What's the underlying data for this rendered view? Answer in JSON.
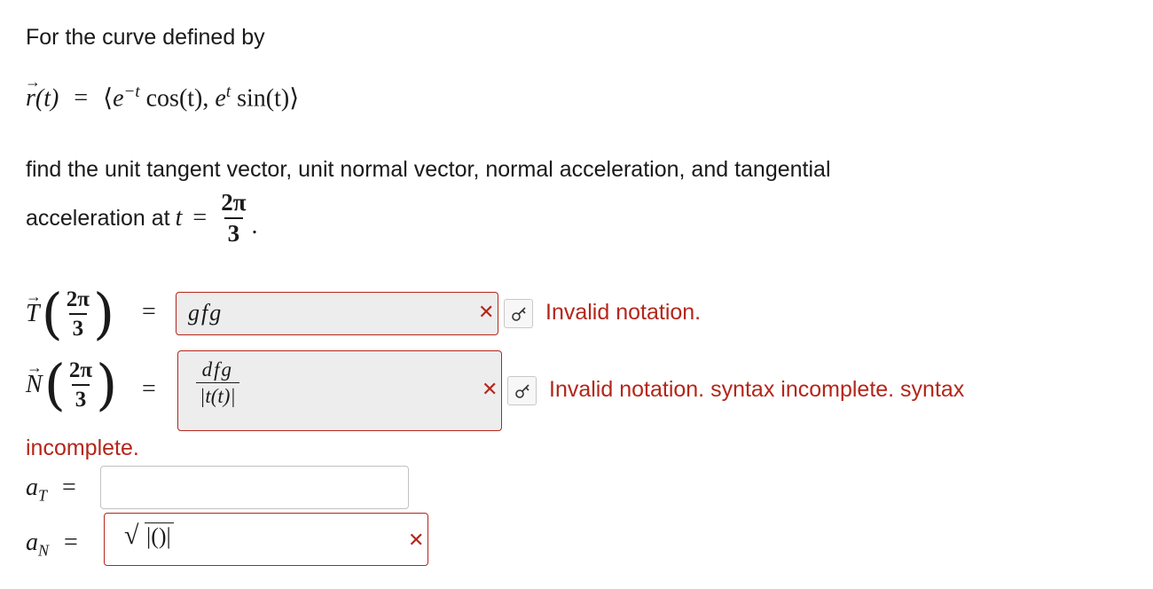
{
  "problem": {
    "intro": "For the curve defined by",
    "r_lhs": "r(t) =",
    "r_comp1_base": "e",
    "r_comp1_exp": "−t",
    "r_comp1_rest": "cos(t),",
    "r_comp2_base": "e",
    "r_comp2_exp": "t",
    "r_comp2_rest": "sin(t)",
    "instruction_line1": "find the unit tangent vector, unit normal vector, normal acceleration, and tangential",
    "instruction_line2": "acceleration at",
    "t_var": "t",
    "equals": "=",
    "frac_num": "2π",
    "frac_den": "3",
    "period": "."
  },
  "rows": {
    "tangent": {
      "symbol": "T",
      "frac_num": "2π",
      "frac_den": "3",
      "equals": "=",
      "value": "gfg",
      "error": "Invalid notation."
    },
    "normal": {
      "symbol": "N",
      "frac_num": "2π",
      "frac_den": "3",
      "equals": "=",
      "value_num": "dfg",
      "value_den": "|t(t)|",
      "error": "Invalid notation. syntax incomplete. syntax",
      "error_wrap": "incomplete."
    },
    "a_t": {
      "symbol": "a",
      "subscript": "T",
      "equals": "=",
      "value": ""
    },
    "a_n": {
      "symbol": "a",
      "subscript": "N",
      "equals": "=",
      "radical": "√",
      "value": "|()|"
    }
  },
  "icons": {
    "error": "x-icon",
    "keyboard": "key-icon"
  },
  "colors": {
    "error": "#b4261a",
    "input_bg": "#ededed",
    "text": "#1a1a1a"
  }
}
